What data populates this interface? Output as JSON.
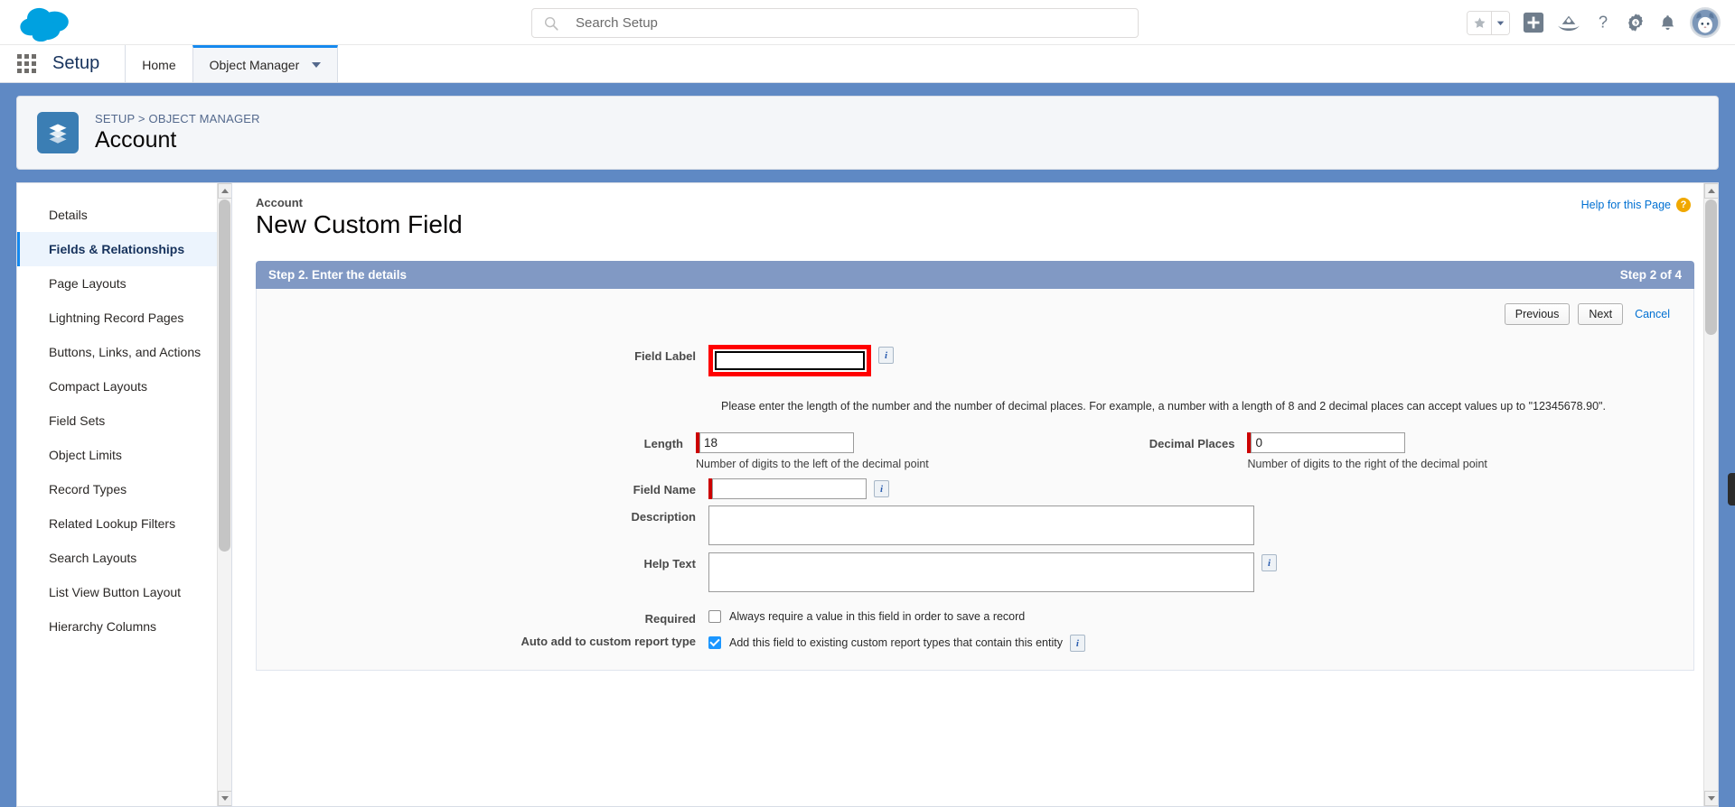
{
  "header": {
    "logo": "salesforce-cloud-logo",
    "search": {
      "placeholder": "Search Setup",
      "value": ""
    },
    "icons": [
      {
        "name": "favorites-star-icon",
        "glyph": "★"
      },
      {
        "name": "favorites-dropdown-icon",
        "glyph": "▾"
      },
      {
        "name": "global-actions-icon",
        "glyph": "+"
      },
      {
        "name": "trailhead-icon",
        "glyph": "⛰"
      },
      {
        "name": "help-icon",
        "glyph": "?"
      },
      {
        "name": "setup-gear-icon",
        "glyph": "⚙"
      },
      {
        "name": "notifications-bell-icon",
        "glyph": "🔔"
      },
      {
        "name": "user-avatar",
        "glyph": ""
      }
    ]
  },
  "setup_nav": {
    "app_launcher": "app-launcher-waffle-icon",
    "title": "Setup",
    "tabs": [
      {
        "label": "Home",
        "active": false,
        "has_caret": false
      },
      {
        "label": "Object Manager",
        "active": true,
        "has_caret": true
      }
    ]
  },
  "record_header": {
    "icon": "object-layers-icon",
    "breadcrumb": {
      "root": "SETUP",
      "separator": ">",
      "current": "OBJECT MANAGER"
    },
    "object_name": "Account"
  },
  "sidebar": {
    "items": [
      {
        "label": "Details",
        "active": false
      },
      {
        "label": "Fields & Relationships",
        "active": true
      },
      {
        "label": "Page Layouts",
        "active": false
      },
      {
        "label": "Lightning Record Pages",
        "active": false
      },
      {
        "label": "Buttons, Links, and Actions",
        "active": false
      },
      {
        "label": "Compact Layouts",
        "active": false
      },
      {
        "label": "Field Sets",
        "active": false
      },
      {
        "label": "Object Limits",
        "active": false
      },
      {
        "label": "Record Types",
        "active": false
      },
      {
        "label": "Related Lookup Filters",
        "active": false
      },
      {
        "label": "Search Layouts",
        "active": false
      },
      {
        "label": "List View Button Layout",
        "active": false
      },
      {
        "label": "Hierarchy Columns",
        "active": false
      }
    ]
  },
  "main": {
    "eyebrow": "Account",
    "title": "New Custom Field",
    "help_link": "Help for this Page",
    "help_badge": "?",
    "step_bar": {
      "left": "Step 2. Enter the details",
      "right": "Step 2 of 4"
    },
    "buttons": {
      "previous": "Previous",
      "next": "Next",
      "cancel": "Cancel"
    },
    "fields": {
      "field_label": {
        "label": "Field Label",
        "value": "",
        "info": "i",
        "highlighted": true
      },
      "helper_text": "Please enter the length of the number and the number of decimal places. For example, a number with a length of 8 and 2 decimal places can accept values up to \"12345678.90\".",
      "length": {
        "label": "Length",
        "value": "18",
        "hint": "Number of digits to the left of the decimal point"
      },
      "decimal_places": {
        "label": "Decimal Places",
        "value": "0",
        "hint": "Number of digits to the right of the decimal point"
      },
      "field_name": {
        "label": "Field Name",
        "value": "",
        "info": "i"
      },
      "description": {
        "label": "Description",
        "value": ""
      },
      "help_text": {
        "label": "Help Text",
        "value": "",
        "info": "i"
      },
      "required": {
        "label": "Required",
        "checkbox_text": "Always require a value in this field in order to save a record",
        "checked": false
      },
      "auto_add_report_type": {
        "label": "Auto add to custom report type",
        "checkbox_text": "Add this field to existing custom report types that contain this entity",
        "checked": true,
        "info": "i"
      }
    }
  },
  "colors": {
    "brand_blue": "#1589ee",
    "banner_blue": "#5f89c4",
    "step_bar": "#8199c4",
    "highlight_red": "#ff0000",
    "link_blue": "#0070d2",
    "required_red": "#cc0000"
  }
}
